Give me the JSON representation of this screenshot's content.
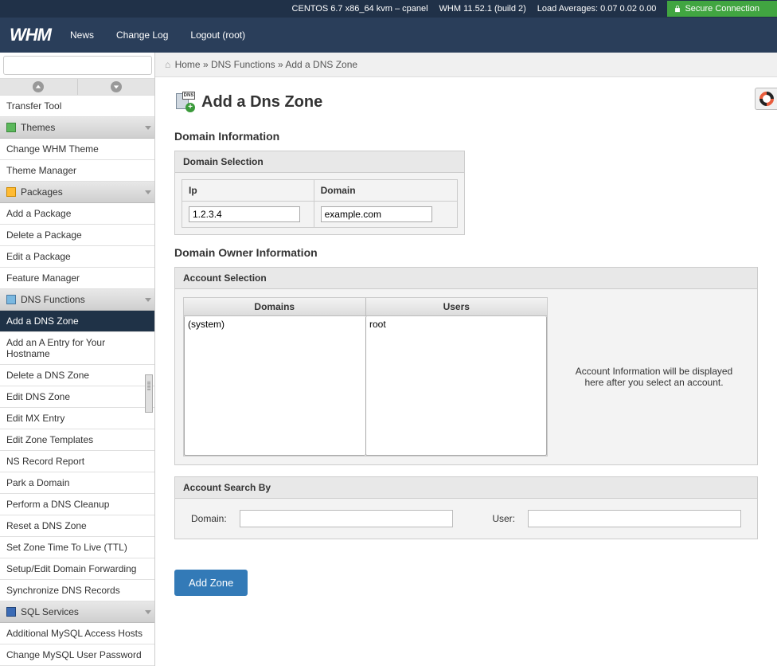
{
  "topbar": {
    "os": "CENTOS 6.7 x86_64 kvm – cpanel",
    "whm": "WHM 11.52.1 (build 2)",
    "load": "Load Averages: 0.07 0.02 0.00",
    "secure": "Secure Connection"
  },
  "nav": {
    "logo": "WHM",
    "news": "News",
    "changelog": "Change Log",
    "logout": "Logout (root)"
  },
  "breadcrumb": {
    "home": "Home",
    "sep1": " » ",
    "dns": "DNS Functions",
    "sep2": " » ",
    "current": "Add a DNS Zone"
  },
  "sidebar": {
    "transfer_tool": "Transfer Tool",
    "themes_header": "Themes",
    "change_theme": "Change WHM Theme",
    "theme_manager": "Theme Manager",
    "packages_header": "Packages",
    "add_package": "Add a Package",
    "delete_package": "Delete a Package",
    "edit_package": "Edit a Package",
    "feature_manager": "Feature Manager",
    "dns_header": "DNS Functions",
    "add_dns_zone": "Add a DNS Zone",
    "add_a_entry": "Add an A Entry for Your Hostname",
    "delete_dns_zone": "Delete a DNS Zone",
    "edit_dns_zone": "Edit DNS Zone",
    "edit_mx": "Edit MX Entry",
    "edit_zone_templates": "Edit Zone Templates",
    "ns_record": "NS Record Report",
    "park_domain": "Park a Domain",
    "dns_cleanup": "Perform a DNS Cleanup",
    "reset_dns": "Reset a DNS Zone",
    "set_ttl": "Set Zone Time To Live (TTL)",
    "setup_forwarding": "Setup/Edit Domain Forwarding",
    "sync_dns": "Synchronize DNS Records",
    "sql_header": "SQL Services",
    "mysql_hosts": "Additional MySQL Access Hosts",
    "mysql_password": "Change MySQL User Password"
  },
  "page": {
    "title": "Add a Dns Zone",
    "icon_dns": "DNS",
    "domain_info": "Domain Information",
    "domain_selection": "Domain Selection",
    "ip_label": "Ip",
    "ip_value": "1.2.3.4",
    "domain_label": "Domain",
    "domain_value": "example.com",
    "owner_info": "Domain Owner Information",
    "account_selection": "Account Selection",
    "domains_col": "Domains",
    "users_col": "Users",
    "domains_option": "(system)",
    "users_option": "root",
    "account_info_text": "Account Information will be displayed here after you select an account.",
    "search_by": "Account Search By",
    "search_domain_label": "Domain:",
    "search_user_label": "User:",
    "add_button": "Add Zone"
  }
}
